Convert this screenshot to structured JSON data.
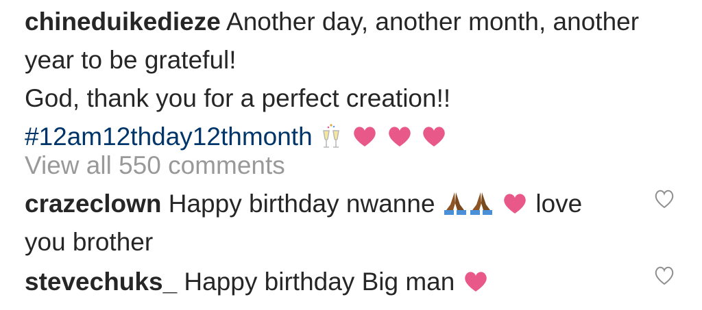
{
  "post": {
    "username": "chineduikedieze",
    "caption_line1": " Another day, another month, another year to be grateful!",
    "caption_line2": "God, thank you for a perfect creation!!",
    "hashtag": "#12am12thday12thmonth",
    "caption_emojis": [
      "champagne-glasses",
      "pink-heart",
      "pink-heart",
      "pink-heart"
    ]
  },
  "view_all_comments": "View all 550 comments",
  "comments": [
    {
      "username": "crazeclown",
      "text_before": " Happy birthday nwanne ",
      "emojis": [
        "folded-hands-medium-dark",
        "folded-hands-medium-dark",
        "pink-heart"
      ],
      "text_after": " love you brother"
    },
    {
      "username": "stevechuks_",
      "text_before": " Happy birthday Big man ",
      "emojis": [
        "pink-heart"
      ],
      "text_after": ""
    }
  ],
  "colors": {
    "text": "#262626",
    "hashtag": "#003569",
    "muted": "#999999",
    "heart_emoji": "#e8598a",
    "like_icon": "#8e8e8e"
  }
}
